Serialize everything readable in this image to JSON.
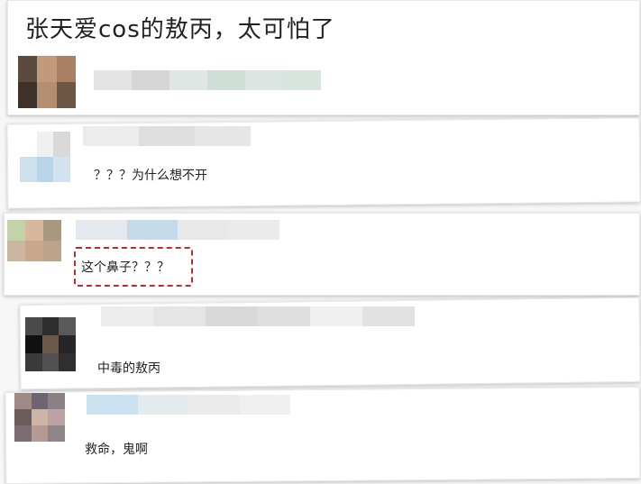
{
  "post": {
    "title": "张天爱cos的敖丙，太可怕了"
  },
  "comments": [
    {
      "text": "？？？为什么想不开"
    },
    {
      "text": "这个鼻子？？？"
    },
    {
      "text": "中毒的敖丙"
    },
    {
      "text": "救命，鬼啊"
    }
  ],
  "colors": {
    "highlight_border": "#c22a2a",
    "card_background": "#ffffff",
    "page_background": "#f7f7f7"
  }
}
